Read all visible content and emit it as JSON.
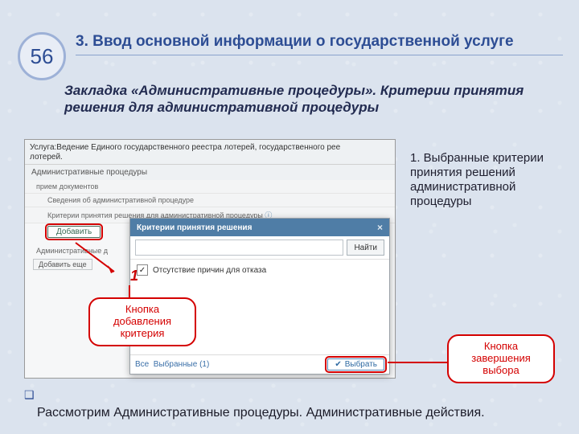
{
  "page_number": "56",
  "title": "3. Ввод основной информации о государственной услуге",
  "subtitle": "Закладка «Административные процедуры». Критерии принятия решения для административной процедуры",
  "side_note": "1. Выбранные критерии принятия решений административной процедуры",
  "footer_note": "Рассмотрим Административные процедуры. Административные действия.",
  "marker_1": "1",
  "callouts": {
    "add_button": "Кнопка добавления критерия",
    "finish_button": "Кнопка завершения выбора"
  },
  "screenshot": {
    "service_line1": "Услуга:Ведение Единого государственного реестра лотерей, государственного рее",
    "service_line2": "лотерей.",
    "tab": "Административные процедуры",
    "row_intake": "прием документов",
    "row_info": "Сведения об административной процедуре",
    "row_criteria": "Критерии принятия решения для административной процедуры",
    "add_label": "Добавить",
    "admin_actions": "Административные д",
    "add_more": "Добавить еще",
    "popup": {
      "title": "Критерии принятия решения",
      "close": "×",
      "search_placeholder": "",
      "find": "Найти",
      "item1": "Отсутствие причин для отказа",
      "footer_all": "Все",
      "footer_selected": "Выбранные (1)",
      "pick": "Выбрать"
    }
  }
}
